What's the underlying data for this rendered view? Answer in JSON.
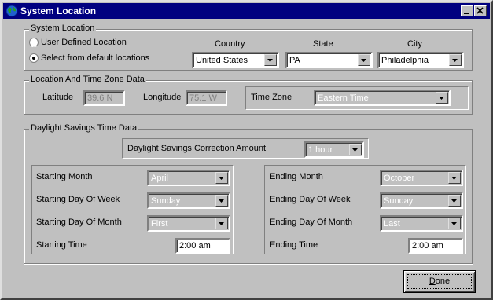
{
  "window": {
    "title": "System Location"
  },
  "system_location": {
    "group_label": "System Location",
    "radio_user_defined": "User Defined Location",
    "radio_default": "Select from default locations",
    "selected": "default",
    "country_label": "Country",
    "state_label": "State",
    "city_label": "City",
    "country_value": "United States",
    "state_value": "PA",
    "city_value": "Philadelphia"
  },
  "location_tz": {
    "group_label": "Location And Time Zone Data",
    "latitude_label": "Latitude",
    "latitude_value": "39.6 N",
    "longitude_label": "Longitude",
    "longitude_value": "75.1 W",
    "timezone_label": "Time Zone",
    "timezone_value": "Eastern Time"
  },
  "dst": {
    "group_label": "Daylight Savings Time Data",
    "correction_label": "Daylight Savings Correction Amount",
    "correction_value": "1 hour",
    "starting_month_label": "Starting Month",
    "starting_month_value": "April",
    "starting_dow_label": "Starting Day Of Week",
    "starting_dow_value": "Sunday",
    "starting_dom_label": "Starting Day Of Month",
    "starting_dom_value": "First",
    "starting_time_label": "Starting Time",
    "starting_time_value": "2:00 am",
    "ending_month_label": "Ending Month",
    "ending_month_value": "October",
    "ending_dow_label": "Ending Day Of Week",
    "ending_dow_value": "Sunday",
    "ending_dom_label": "Ending Day Of Month",
    "ending_dom_value": "Last",
    "ending_time_label": "Ending Time",
    "ending_time_value": "2:00 am"
  },
  "done_label_underlined": "D",
  "done_label_rest": "one"
}
